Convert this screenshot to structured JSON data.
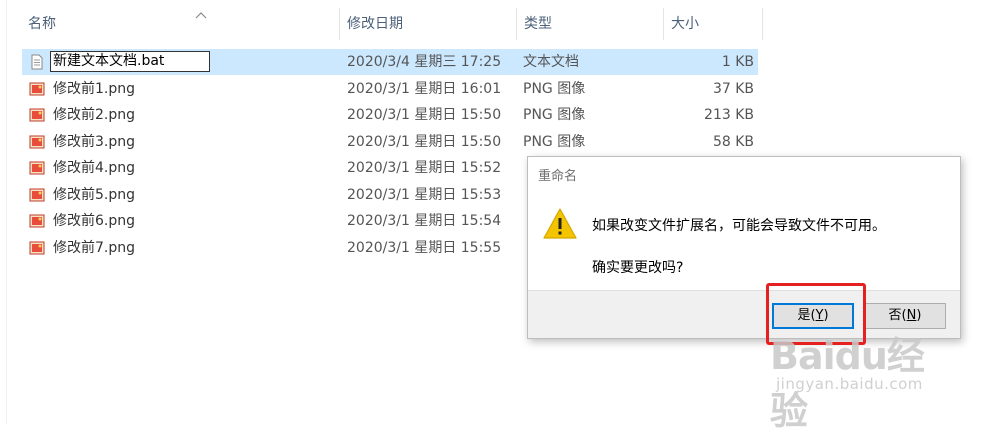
{
  "columns": {
    "name": "名称",
    "date": "修改日期",
    "type": "类型",
    "size": "大小"
  },
  "files": [
    {
      "name": "新建文本文档.bat",
      "date": "2020/3/4 星期三 17:25",
      "type": "文本文档",
      "size": "1 KB",
      "selected": true,
      "editing": true,
      "icon": "text-file-icon"
    },
    {
      "name": "修改前1.png",
      "date": "2020/3/1 星期日 16:01",
      "type": "PNG 图像",
      "size": "37 KB",
      "icon": "image-file-icon"
    },
    {
      "name": "修改前2.png",
      "date": "2020/3/1 星期日 15:50",
      "type": "PNG 图像",
      "size": "213 KB",
      "icon": "image-file-icon"
    },
    {
      "name": "修改前3.png",
      "date": "2020/3/1 星期日 15:50",
      "type": "PNG 图像",
      "size": "58 KB",
      "icon": "image-file-icon"
    },
    {
      "name": "修改前4.png",
      "date": "2020/3/1 星期日 15:52",
      "type": "",
      "size": "",
      "icon": "image-file-icon"
    },
    {
      "name": "修改前5.png",
      "date": "2020/3/1 星期日 15:53",
      "type": "",
      "size": "",
      "icon": "image-file-icon"
    },
    {
      "name": "修改前6.png",
      "date": "2020/3/1 星期日 15:54",
      "type": "",
      "size": "",
      "icon": "image-file-icon"
    },
    {
      "name": "修改前7.png",
      "date": "2020/3/1 星期日 15:55",
      "type": "",
      "size": "",
      "icon": "image-file-icon"
    }
  ],
  "dialog": {
    "title": "重命名",
    "message": "如果改变文件扩展名，可能会导致文件不可用。",
    "question": "确实要更改吗?",
    "yes_label": "是(",
    "yes_accel": "Y",
    "yes_close": ")",
    "no_label": "否(",
    "no_accel": "N",
    "no_close": ")",
    "icon": "warning-icon"
  },
  "watermark": {
    "brand": "Baidu经验",
    "url": "jingyan.baidu.com"
  },
  "colors": {
    "selection": "#cce8ff",
    "header_text": "#4c607a",
    "highlight": "#e52020",
    "default_button_border": "#0078d7",
    "warning": "#f5c400"
  }
}
